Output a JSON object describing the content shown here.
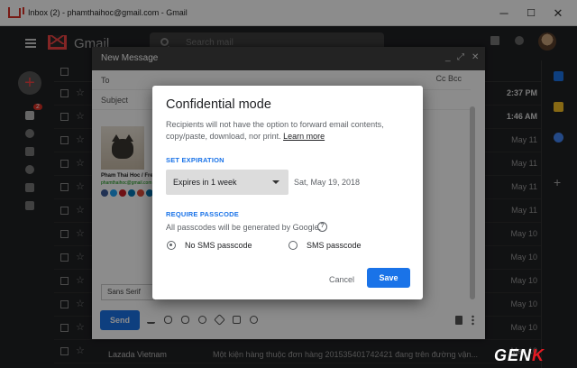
{
  "window": {
    "title": "Inbox (2) - phamthaihoc@gmail.com - Gmail",
    "minimize": "─",
    "maximize": "☐",
    "close": "✕"
  },
  "gmail": {
    "logo_text": "Gmail",
    "search_placeholder": "Search mail",
    "inbox_badge": "2"
  },
  "inbox_rows": [
    {
      "date": "2:37 PM",
      "bold": true
    },
    {
      "date": "1:46 AM",
      "bold": true
    },
    {
      "date": "May 11",
      "bold": false
    },
    {
      "date": "May 11",
      "bold": false
    },
    {
      "date": "May 11",
      "bold": false
    },
    {
      "date": "May 11",
      "bold": false
    },
    {
      "date": "May 10",
      "bold": false
    },
    {
      "date": "May 10",
      "bold": false
    },
    {
      "date": "May 10",
      "bold": false
    },
    {
      "date": "May 10",
      "bold": false
    },
    {
      "date": "May 10",
      "bold": false
    },
    {
      "date": "May 10",
      "bold": false
    }
  ],
  "bottom_row": {
    "sender": "Lazada Vietnam",
    "subject": "Một kiện hàng thuộc đơn hàng 201535401742421 đang trên đường vận..."
  },
  "compose": {
    "title": "New Message",
    "to_label": "To",
    "cc_bcc": "Cc Bcc",
    "subject_label": "Subject",
    "signature_name": "Pham Thai Hoc / Free",
    "signature_sub": "phamthaihoc@gmail.com",
    "font_select": "Sans Serif",
    "send_label": "Send"
  },
  "dialog": {
    "title": "Confidential mode",
    "description": "Recipients will not have the option to forward email contents, copy/paste, download, nor print.",
    "learn_more": "Learn more",
    "set_expiration_heading": "SET EXPIRATION",
    "expiration_value": "Expires in 1 week",
    "expiration_date": "Sat, May 19, 2018",
    "require_passcode_heading": "REQUIRE PASSCODE",
    "passcode_info": "All passcodes will be generated by Google.",
    "option_no_sms": "No SMS passcode",
    "option_sms": "SMS passcode",
    "cancel_label": "Cancel",
    "save_label": "Save"
  },
  "watermark": {
    "text": "GEN",
    "accent": "K"
  },
  "colors": {
    "accent": "#1a73e8",
    "gmail_red": "#d93025"
  }
}
